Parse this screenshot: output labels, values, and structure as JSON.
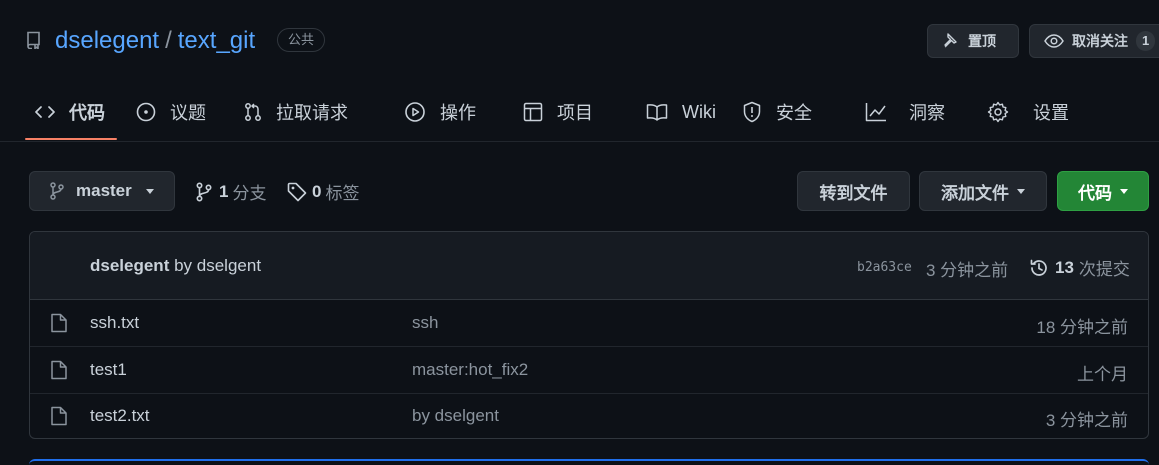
{
  "repo": {
    "owner": "dselegent",
    "separator": "/",
    "name": "text_git",
    "visibility": "公共"
  },
  "header_actions": {
    "pin_label": "置顶",
    "watch_label": "取消关注",
    "watch_count": "1"
  },
  "tabs": [
    {
      "label": "代码",
      "icon": "code-icon",
      "active": true
    },
    {
      "label": "议题",
      "icon": "issue-icon"
    },
    {
      "label": "拉取请求",
      "icon": "pull-request-icon"
    },
    {
      "label": "操作",
      "icon": "play-icon"
    },
    {
      "label": "项目",
      "icon": "table-icon"
    },
    {
      "label": "Wiki",
      "icon": "book-icon"
    },
    {
      "label": "安全",
      "icon": "shield-icon"
    },
    {
      "label": "洞察",
      "icon": "graph-icon"
    },
    {
      "label": "设置",
      "icon": "gear-icon"
    }
  ],
  "toolbar": {
    "branch": "master",
    "branch_count": "1",
    "branch_label": "分支",
    "tag_count": "0",
    "tag_label": "标签",
    "goto_file": "转到文件",
    "add_file": "添加文件",
    "code": "代码"
  },
  "latest_commit": {
    "author": "dselegent",
    "by": "by dselgent",
    "sha": "b2a63ce",
    "time": "3 分钟之前",
    "commit_count": "13",
    "commit_label": "次提交"
  },
  "files": [
    {
      "name": "ssh.txt",
      "message": "ssh",
      "age": "18 分钟之前"
    },
    {
      "name": "test1",
      "message": "master:hot_fix2",
      "age": "上个月"
    },
    {
      "name": "test2.txt",
      "message": "by dselgent",
      "age": "3 分钟之前"
    }
  ],
  "colors": {
    "background": "#0d1117",
    "link": "#58a6ff",
    "accent_underline": "#f78166",
    "primary_button": "#238636"
  }
}
